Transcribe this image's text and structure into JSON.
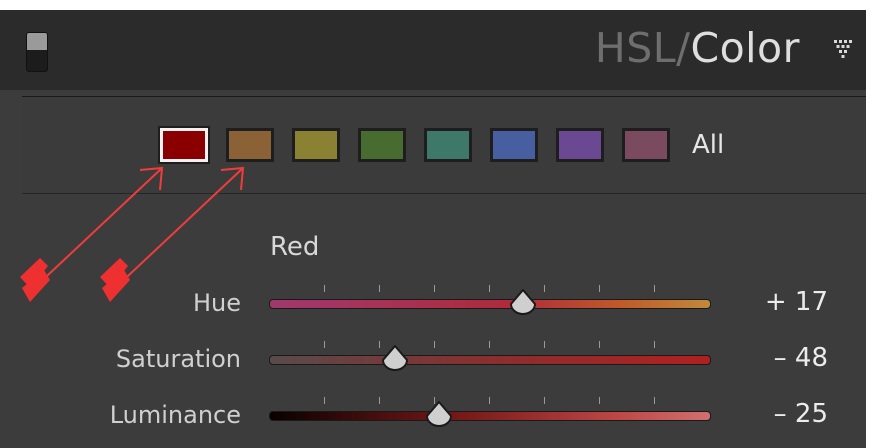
{
  "header": {
    "title_hsl": "HSL",
    "title_separator": "/",
    "title_color": "Color"
  },
  "swatches": [
    {
      "name": "red",
      "color": "#8a0000",
      "selected": true
    },
    {
      "name": "orange",
      "color": "#8a6236"
    },
    {
      "name": "yellow",
      "color": "#8a8232"
    },
    {
      "name": "green",
      "color": "#486b30"
    },
    {
      "name": "aqua",
      "color": "#3e7868"
    },
    {
      "name": "blue",
      "color": "#475fa0"
    },
    {
      "name": "purple",
      "color": "#6a4992"
    },
    {
      "name": "magenta",
      "color": "#7a4a5e"
    }
  ],
  "swatch_all_label": "All",
  "section_label": "Red",
  "sliders": {
    "hue": {
      "label": "Hue",
      "value_text": "+ 17",
      "value": 17
    },
    "saturation": {
      "label": "Saturation",
      "value_text": "– 48",
      "value": -48
    },
    "luminance": {
      "label": "Luminance",
      "value_text": "– 25",
      "value": -25
    }
  },
  "colors": {
    "panel_bg": "#3c3c3c",
    "header_bg": "#2b2b2b",
    "annotation_arrow": "#f03c3c"
  }
}
